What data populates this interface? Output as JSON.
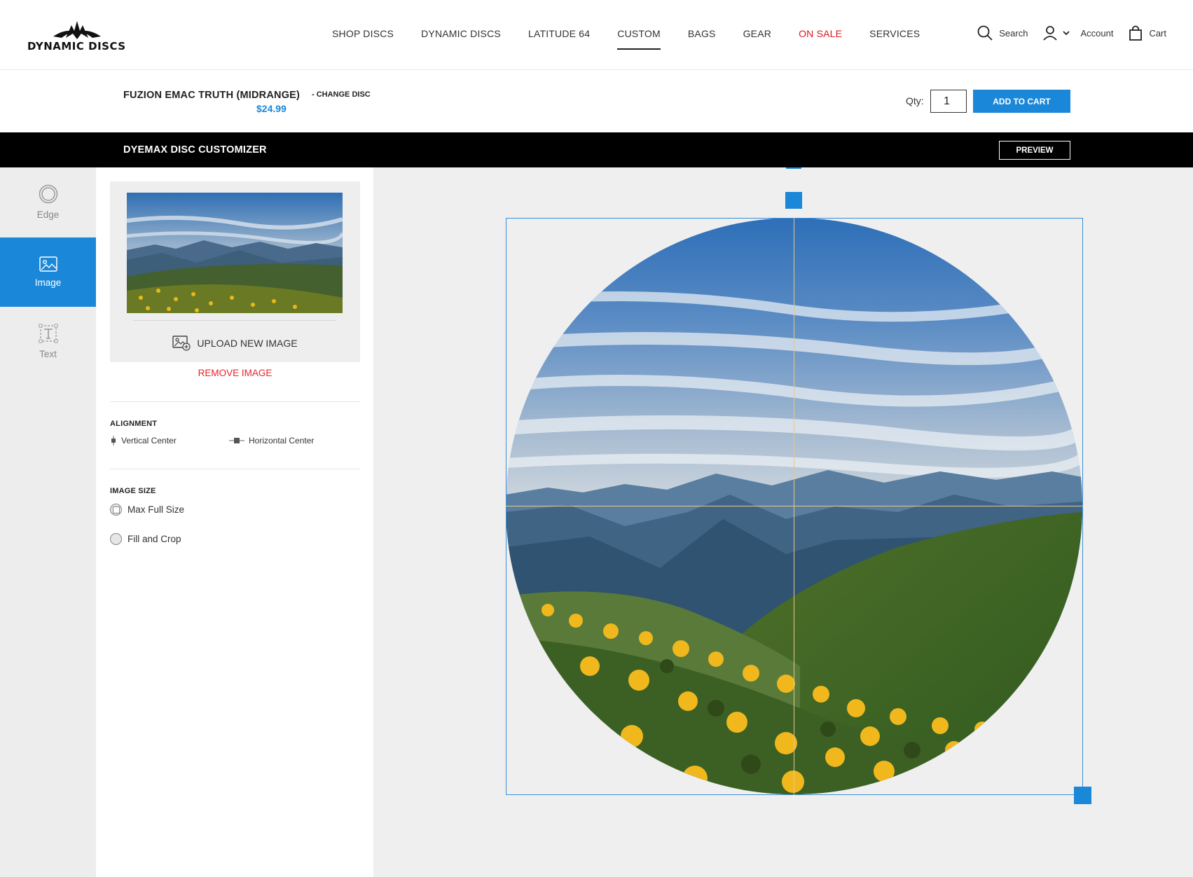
{
  "brand": {
    "logo_text": "DYNAMIC DISCS"
  },
  "nav": {
    "items": [
      {
        "label": "SHOP DISCS"
      },
      {
        "label": "DYNAMIC DISCS"
      },
      {
        "label": "LATITUDE 64"
      },
      {
        "label": "CUSTOM"
      },
      {
        "label": "BAGS"
      },
      {
        "label": "GEAR"
      },
      {
        "label": "ON SALE"
      },
      {
        "label": "SERVICES"
      }
    ],
    "active": "CUSTOM"
  },
  "header_tools": {
    "search": "Search",
    "account": "Account",
    "cart": "Cart"
  },
  "product": {
    "name": "FUZION EMAC TRUTH (MIDRANGE)",
    "price": "$24.99",
    "change_disc": "- CHANGE DISC",
    "qty_label": "Qty:",
    "qty_value": "1",
    "add_to_cart": "ADD TO CART"
  },
  "customizer": {
    "title": "DYEMAX DISC CUSTOMIZER",
    "preview": "PREVIEW"
  },
  "rail": {
    "items": [
      {
        "label": "Edge",
        "icon": "circle-ring-icon"
      },
      {
        "label": "Image",
        "icon": "image-icon"
      },
      {
        "label": "Text",
        "icon": "text-box-icon"
      }
    ],
    "active": "Image"
  },
  "options": {
    "upload": "UPLOAD NEW IMAGE",
    "remove": "REMOVE IMAGE",
    "alignment_title": "ALIGNMENT",
    "align_vertical": "Vertical Center",
    "align_horizontal": "Horizontal Center",
    "size_title": "IMAGE SIZE",
    "size_max": "Max Full Size",
    "size_fill": "Fill and Crop",
    "selected_size": "Max Full Size"
  },
  "colors": {
    "accent": "#1b87d8",
    "sale": "#d71920",
    "remove": "#e8232b",
    "bar": "#000000",
    "canvas_bg": "#efefef"
  }
}
